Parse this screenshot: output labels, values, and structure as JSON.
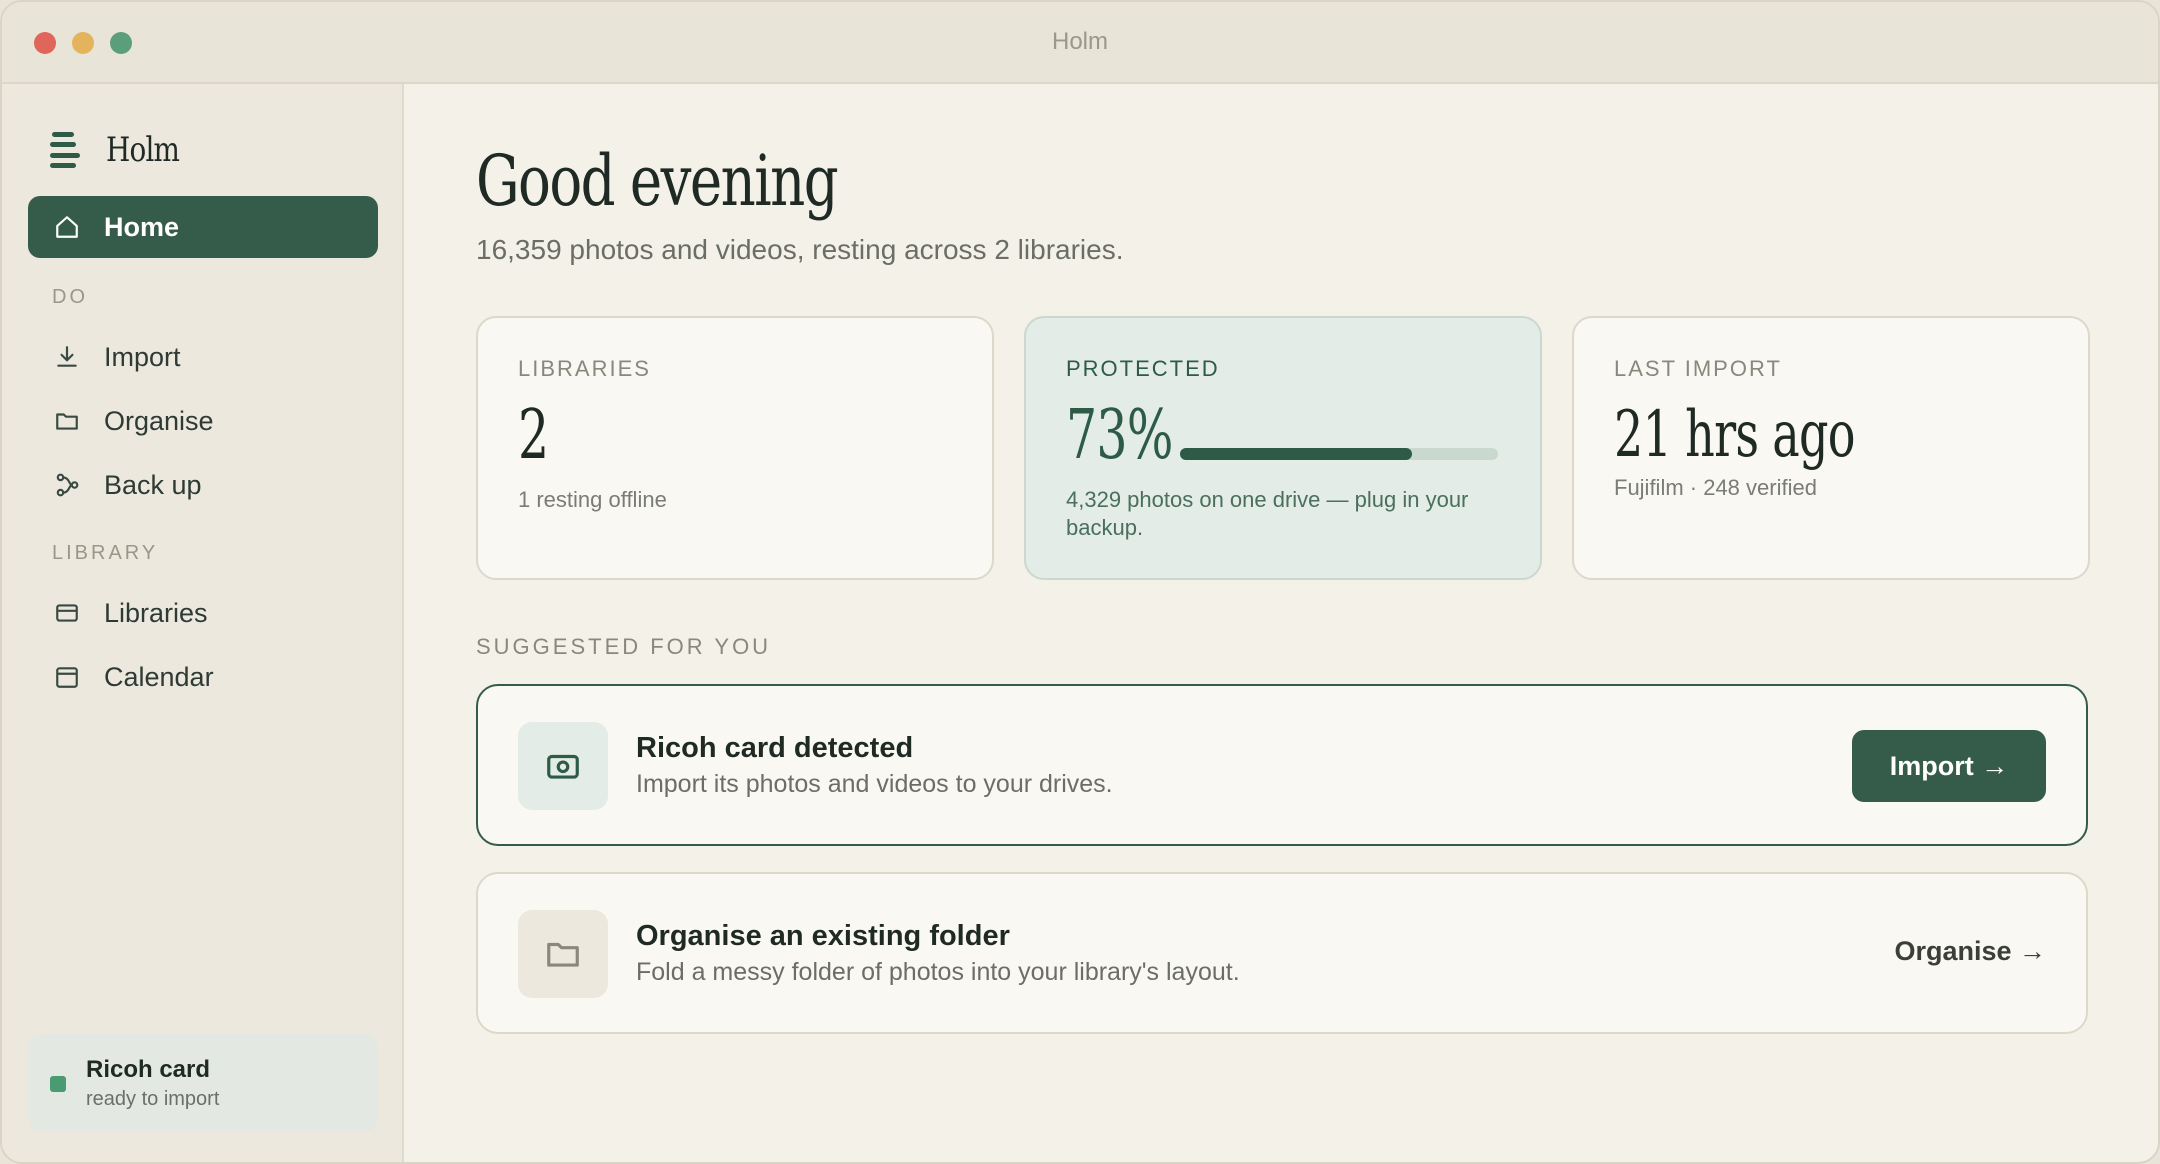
{
  "window": {
    "title": "Holm"
  },
  "sidebar": {
    "brand": "Holm",
    "home": {
      "label": "Home",
      "icon": "home-icon"
    },
    "sections": [
      {
        "label": "DO",
        "items": [
          {
            "label": "Import",
            "icon": "download-icon"
          },
          {
            "label": "Organise",
            "icon": "folder-icon"
          },
          {
            "label": "Back up",
            "icon": "backup-icon"
          }
        ]
      },
      {
        "label": "LIBRARY",
        "items": [
          {
            "label": "Libraries",
            "icon": "library-icon"
          },
          {
            "label": "Calendar",
            "icon": "calendar-icon"
          }
        ]
      }
    ],
    "device": {
      "name": "Ricoh card",
      "status": "ready to import",
      "status_color": "#4a9a72"
    }
  },
  "main": {
    "greeting": "Good evening",
    "subtitle": "16,359 photos and videos, resting across 2 libraries.",
    "cards": {
      "libraries": {
        "label": "LIBRARIES",
        "value": "2",
        "note": "1 resting offline"
      },
      "protected": {
        "label": "PROTECTED",
        "value": "73%",
        "progress": 0.73,
        "note": "4,329 photos on one drive — plug in your backup."
      },
      "last_import": {
        "label": "LAST IMPORT",
        "value": "21 hrs ago",
        "note": "Fujifilm · 248 verified"
      }
    },
    "suggested_label": "SUGGESTED FOR YOU",
    "suggestions": [
      {
        "title": "Ricoh card detected",
        "description": "Import its photos and videos to your drives.",
        "action": "Import →",
        "icon": "camera-icon"
      },
      {
        "title": "Organise an existing folder",
        "description": "Fold a messy folder of photos into your library's layout.",
        "action": "Organise →",
        "icon": "folder-icon"
      }
    ]
  },
  "colors": {
    "accent": "#355c4b",
    "background": "#f4f1e8",
    "sidebar": "#ece8dd"
  }
}
